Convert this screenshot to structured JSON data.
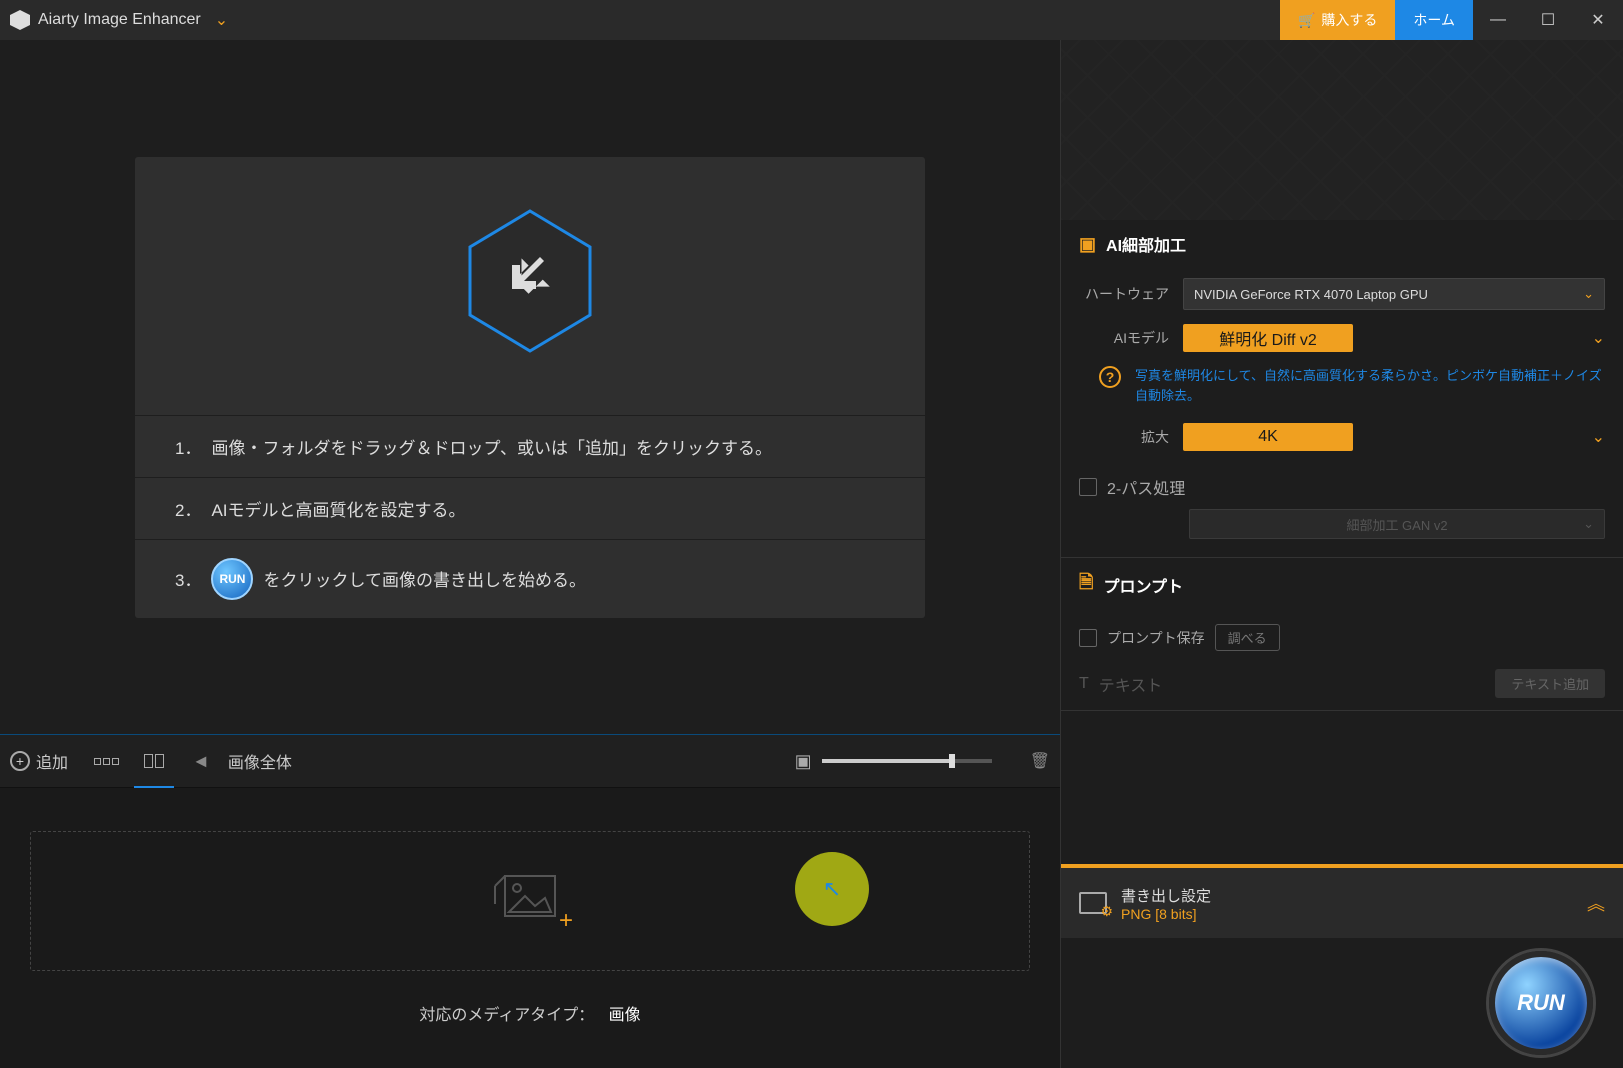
{
  "titlebar": {
    "app_name": "Aiarty Image Enhancer",
    "buy_label": "購入する",
    "home_label": "ホーム"
  },
  "canvas": {
    "step1_num": "1．",
    "step1_text": "画像・フォルダをドラッグ＆ドロップ、或いは「追加」をクリックする。",
    "step2_num": "2．",
    "step2_text": "AIモデルと高画質化を設定する。",
    "step3_num": "3．",
    "step3_mini": "RUN",
    "step3_text": "をクリックして画像の書き出しを始める。"
  },
  "toolbar": {
    "add_label": "追加",
    "nav_label": "画像全体"
  },
  "thumb": {
    "media_label": "対応のメディアタイプ：",
    "media_value": "画像"
  },
  "panel": {
    "ai_title": "AI細部加工",
    "hardware_label": "ハートウェア",
    "hardware_value": "NVIDIA GeForce RTX 4070 Laptop GPU",
    "model_label": "AIモデル",
    "model_value": "鮮明化 Diff v2",
    "model_desc": "写真を鮮明化にして、自然に高画質化する柔らかさ。ピンボケ自動補正＋ノイズ自動除去。",
    "upscale_label": "拡大",
    "upscale_value": "4K",
    "two_pass_label": "2-パス処理",
    "two_pass_model": "細部加工 GAN v2",
    "prompt_title": "プロンプト",
    "prompt_save_label": "プロンプト保存",
    "prompt_browse_label": "調べる",
    "text_label": "テキスト",
    "text_add_label": "テキスト追加"
  },
  "export": {
    "title": "書き出し設定",
    "format": "PNG   [8 bits]"
  },
  "run": {
    "label": "RUN"
  }
}
